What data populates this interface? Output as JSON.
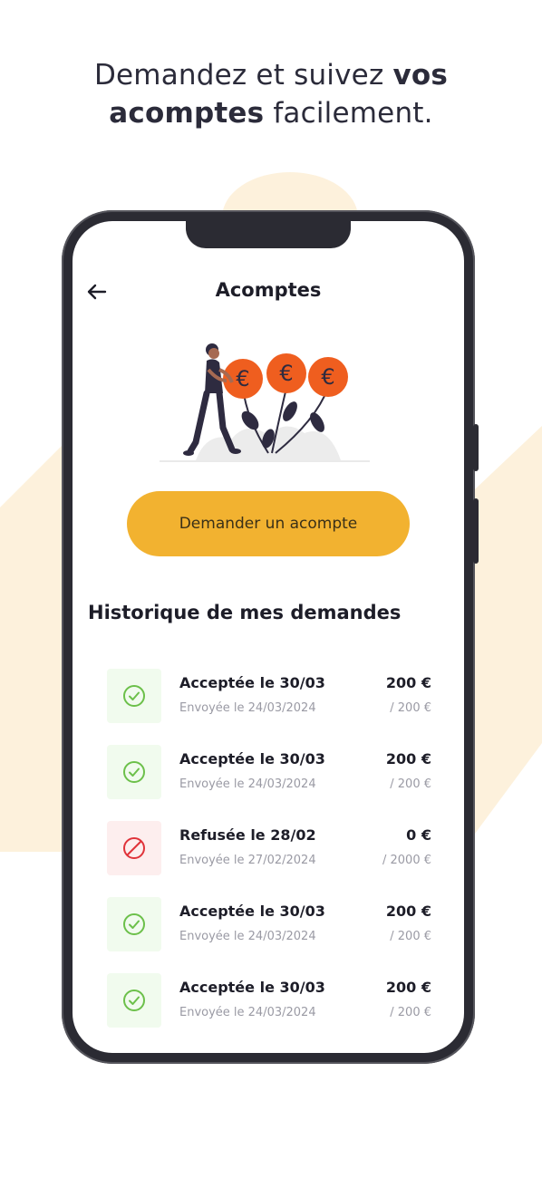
{
  "headline": {
    "part1": "Demandez et suivez ",
    "part2_bold": "vos",
    "part3_bold": "acomptes",
    "part4": " facilement."
  },
  "screen": {
    "title": "Acomptes",
    "back_icon": "arrow-left-icon",
    "cta_label": "Demander un acompte",
    "history_title": "Historique de mes demandes"
  },
  "requests": [
    {
      "status": "accepted",
      "icon": "check-circle-icon",
      "title": "Acceptée le 30/03",
      "sent": "Envoyée le 24/03/2024",
      "amount": "200 €",
      "total": "/ 200 €"
    },
    {
      "status": "accepted",
      "icon": "check-circle-icon",
      "title": "Acceptée le 30/03",
      "sent": "Envoyée le 24/03/2024",
      "amount": "200 €",
      "total": "/ 200 €"
    },
    {
      "status": "refused",
      "icon": "forbidden-icon",
      "title": "Refusée le 28/02",
      "sent": "Envoyée le 27/02/2024",
      "amount": "0 €",
      "total": "/ 2000 €"
    },
    {
      "status": "accepted",
      "icon": "check-circle-icon",
      "title": "Acceptée le 30/03",
      "sent": "Envoyée le 24/03/2024",
      "amount": "200 €",
      "total": "/ 200 €"
    },
    {
      "status": "accepted",
      "icon": "check-circle-icon",
      "title": "Acceptée le 30/03",
      "sent": "Envoyée le 24/03/2024",
      "amount": "200 €",
      "total": "/ 200 €"
    }
  ],
  "colors": {
    "accent": "#f2b230",
    "background_shape": "#fdf0d8",
    "accepted": "#6cc04a",
    "refused": "#e0333a",
    "coin": "#ef5e1f"
  }
}
